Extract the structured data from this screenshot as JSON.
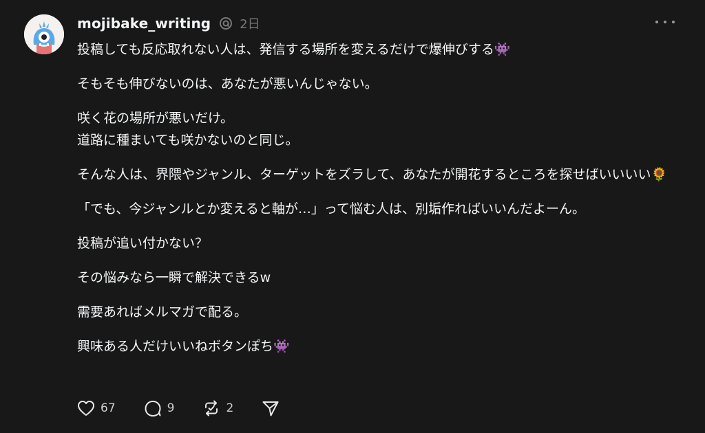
{
  "post": {
    "author": {
      "username": "mojibake_writing",
      "avatar_icon": "monster-avatar-icon",
      "badge_icon": "threads-icon"
    },
    "timestamp": "2日",
    "more_icon": "more-dots-icon",
    "paragraphs": [
      "投稿しても反応取れない人は、発信する場所を変えるだけで爆伸びする👾",
      "そもそも伸びないのは、あなたが悪いんじゃない。",
      "咲く花の場所が悪いだけ。\n道路に種まいても咲かないのと同じ。",
      "そんな人は、界隈やジャンル、ターゲットをズラして、あなたが開花するところを探せばいいいい🌻",
      "「でも、今ジャンルとか変えると軸が…」って悩む人は、別垢作ればいいんだよーん。",
      "投稿が追い付かない？",
      "その悩みなら一瞬で解決できるw",
      "需要あればメルマガで配る。",
      "興味ある人だけいいねボタンぽち👾"
    ],
    "actions": {
      "like": {
        "icon": "heart-icon",
        "count": "67"
      },
      "reply": {
        "icon": "comment-icon",
        "count": "9"
      },
      "repost": {
        "icon": "repost-icon",
        "count": "2"
      },
      "share": {
        "icon": "send-icon"
      }
    }
  },
  "colors": {
    "background": "#181818",
    "text": "#f3f5f7",
    "muted": "#777777"
  }
}
